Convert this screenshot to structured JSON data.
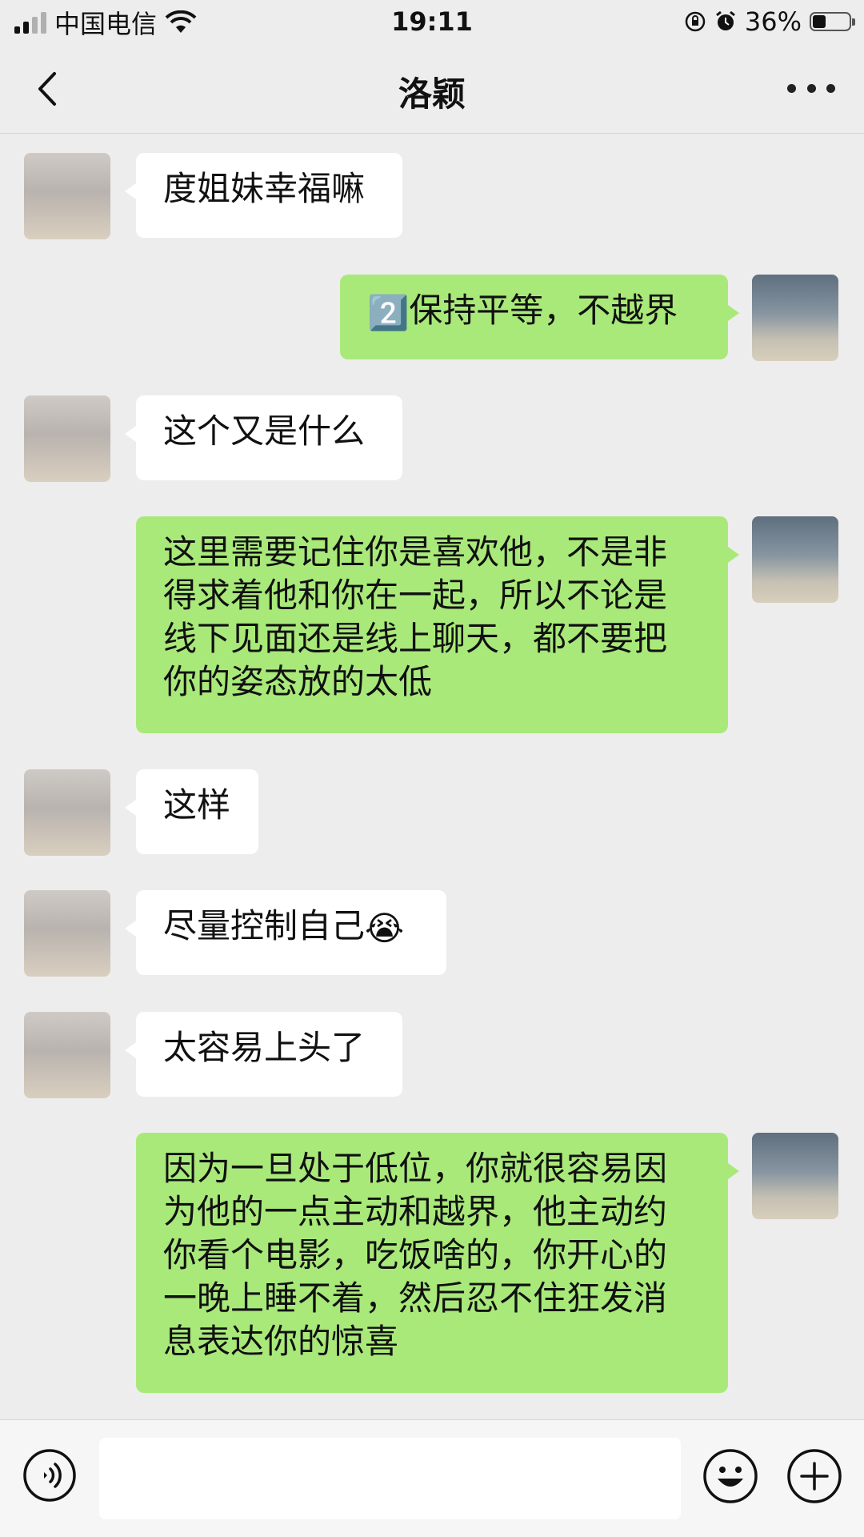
{
  "status_bar": {
    "carrier": "中国电信",
    "time": "19:11",
    "battery_percent": "36%",
    "battery_level": 0.36
  },
  "nav": {
    "title": "洛颖"
  },
  "messages": [
    {
      "side": "in",
      "text": "度姐妹幸福嘛"
    },
    {
      "side": "out",
      "emoji": "2️⃣",
      "text": "保持平等，不越界"
    },
    {
      "side": "in",
      "text": "这个又是什么"
    },
    {
      "side": "out",
      "lines": [
        "这里需要记住你是喜欢他，不是非",
        "得求着他和你在一起，所以不论是",
        "线下见面还是线上聊天，都不要把",
        "你的姿态放的太低"
      ]
    },
    {
      "side": "in",
      "text": "这样"
    },
    {
      "side": "in",
      "text": "尽量控制自己",
      "emoji": "😭"
    },
    {
      "side": "in",
      "text": "太容易上头了"
    },
    {
      "side": "out",
      "lines": [
        "因为一旦处于低位，你就很容易因",
        "为他的一点主动和越界，他主动约",
        "你看个电影，吃饭啥的，你开心的",
        "一晚上睡不着，然后忍不住狂发消",
        "息表达你的惊喜"
      ]
    }
  ],
  "input_bar": {
    "value": ""
  },
  "icons": {
    "back": "chevron-left-icon",
    "more": "more-dots-icon",
    "voice": "voice-icon",
    "emoji": "emoji-icon",
    "plus": "plus-icon",
    "wifi": "wifi-icon",
    "lock": "rotation-lock-icon",
    "alarm": "alarm-icon"
  }
}
